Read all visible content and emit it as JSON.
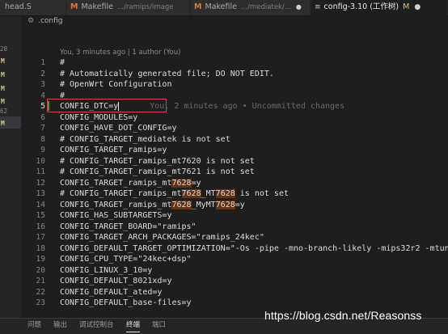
{
  "tabs": [
    {
      "label": "head.S",
      "active": false
    },
    {
      "label": "Makefile",
      "path": ".../ramips/image",
      "icon": "makefile-m-icon",
      "active": false
    },
    {
      "label": "Makefile",
      "path": ".../mediatek/...",
      "icon": "makefile-m-icon",
      "active": false
    },
    {
      "label": "config-3.10 (工作树)",
      "status": "M",
      "icon": "lines-icon",
      "active": true
    }
  ],
  "sidebar": {
    "numbers": [
      "28",
      "62"
    ],
    "markers": [
      "M",
      "M",
      "M",
      "M",
      "M"
    ]
  },
  "breadcrumb": {
    "label": ".config",
    "icon": "gear-icon"
  },
  "codelens": "You, 3 minutes ago | 1 author (You)",
  "lines": [
    {
      "n": "1",
      "text": "#"
    },
    {
      "n": "2",
      "text": "# Automatically generated file; DO NOT EDIT."
    },
    {
      "n": "3",
      "text": "# OpenWrt Configuration"
    },
    {
      "n": "4",
      "text": "#"
    },
    {
      "n": "5",
      "text": "CONFIG_DTC=y",
      "blame": "You, 2 minutes ago • Uncommitted changes"
    },
    {
      "n": "6",
      "text": "CONFIG_MODULES=y"
    },
    {
      "n": "7",
      "text": "CONFIG_HAVE_DOT_CONFIG=y"
    },
    {
      "n": "8",
      "text": "# CONFIG_TARGET_mediatek is not set"
    },
    {
      "n": "9",
      "text": "CONFIG_TARGET_ramips=y"
    },
    {
      "n": "10",
      "text": "# CONFIG_TARGET_ramips_mt7620 is not set"
    },
    {
      "n": "11",
      "text": "# CONFIG_TARGET_ramips_mt7621 is not set"
    },
    {
      "n": "12",
      "parts": [
        {
          "t": "CONFIG_TARGET_ramips_mt"
        },
        {
          "t": "7628",
          "hl": true
        },
        {
          "t": "=y"
        }
      ]
    },
    {
      "n": "13",
      "parts": [
        {
          "t": "# CONFIG_TARGET_ramips_mt"
        },
        {
          "t": "7628",
          "hl": true
        },
        {
          "t": "_MT"
        },
        {
          "t": "7628",
          "hl": true
        },
        {
          "t": " is not set"
        }
      ]
    },
    {
      "n": "14",
      "parts": [
        {
          "t": "CONFIG_TARGET_ramips_mt"
        },
        {
          "t": "7628",
          "hl": true
        },
        {
          "t": "_MyMT"
        },
        {
          "t": "7628",
          "hl": true
        },
        {
          "t": "=y"
        }
      ]
    },
    {
      "n": "15",
      "text": "CONFIG_HAS_SUBTARGETS=y"
    },
    {
      "n": "16",
      "text": "CONFIG_TARGET_BOARD=\"ramips\""
    },
    {
      "n": "17",
      "text": "CONFIG_TARGET_ARCH_PACKAGES=\"ramips_24kec\""
    },
    {
      "n": "18",
      "text": "CONFIG_DEFAULT_TARGET_OPTIMIZATION=\"-Os -pipe -mno-branch-likely -mips32r2 -mtun"
    },
    {
      "n": "19",
      "text": "CONFIG_CPU_TYPE=\"24kec+dsp\""
    },
    {
      "n": "20",
      "text": "CONFIG_LINUX_3_10=y"
    },
    {
      "n": "21",
      "text": "CONFIG_DEFAULT_8021xd=y"
    },
    {
      "n": "22",
      "text": "CONFIG_DEFAULT_ated=y"
    },
    {
      "n": "23",
      "text": "CONFIG_DEFAULT_base-files=y"
    }
  ],
  "panel_tabs": [
    {
      "label": "问题",
      "active": false
    },
    {
      "label": "输出",
      "active": false
    },
    {
      "label": "调试控制台",
      "active": false
    },
    {
      "label": "终端",
      "active": true
    },
    {
      "label": "端口",
      "active": false
    }
  ],
  "watermark": "https://blog.csdn.net/Reasonss",
  "colors": {
    "accent_highlight": "#613214",
    "modified": "#e2c08d",
    "makefile_icon": "#e37933",
    "annotation_box": "#e23c3c"
  }
}
